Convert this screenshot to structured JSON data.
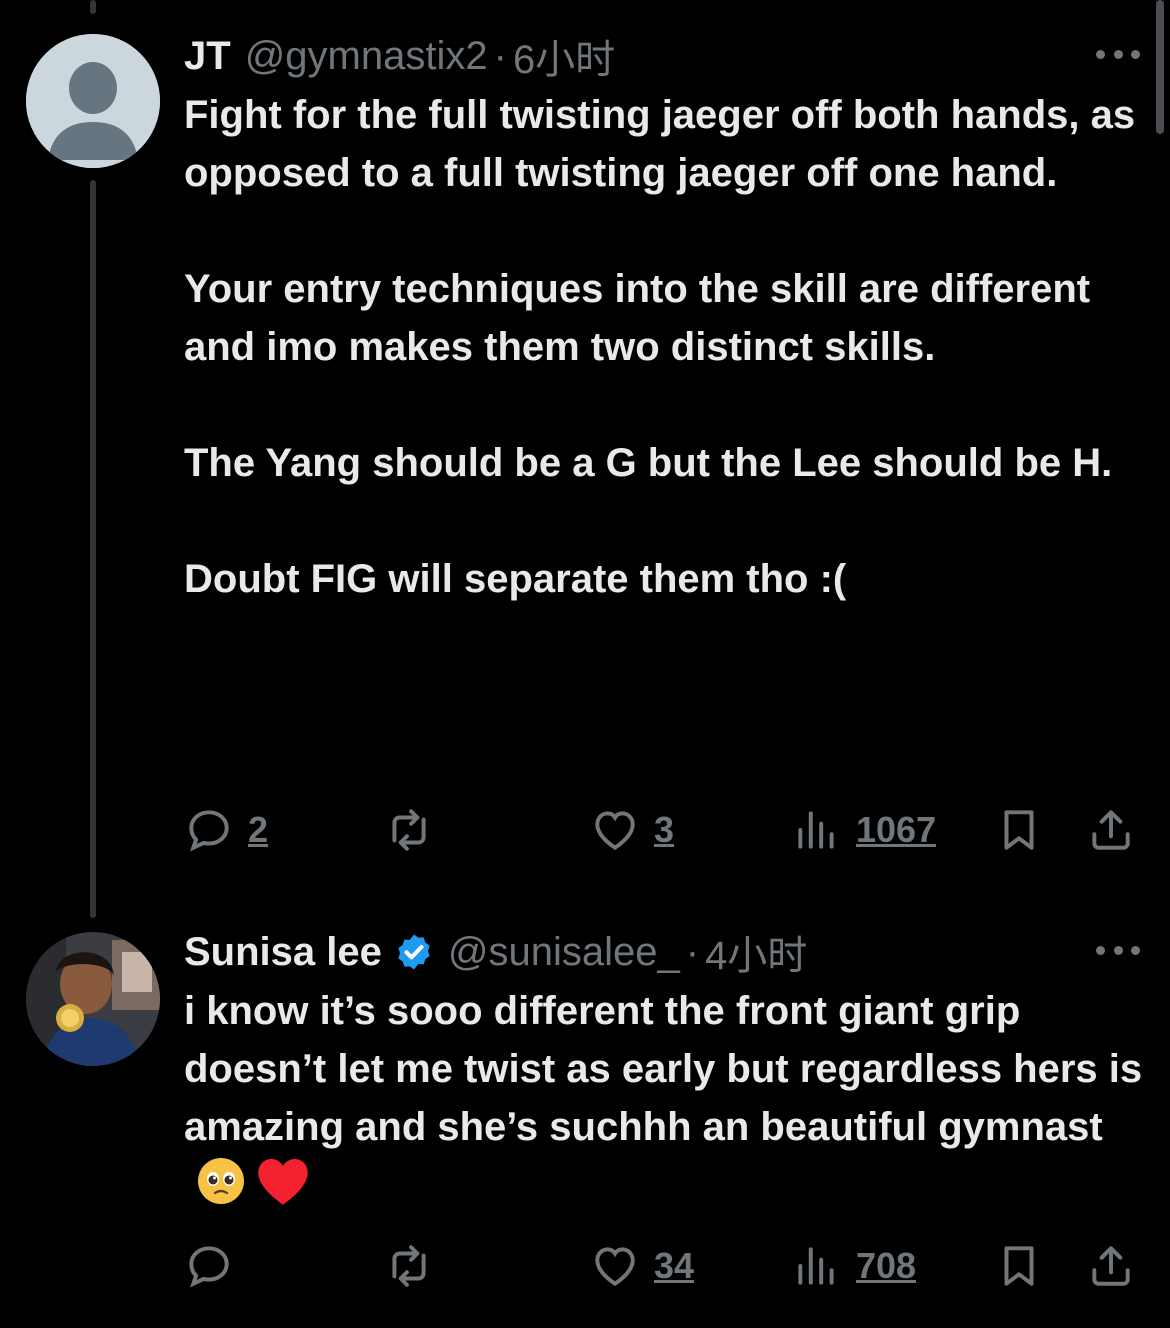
{
  "tweets": [
    {
      "name": "JT",
      "handle": "@gymnastix2",
      "separator": "·",
      "time": "6小时",
      "text": "Fight for the full twisting jaeger off both hands, as opposed to a full twisting jaeger off one hand.\n\nYour entry techniques into the skill are different and imo makes them two distinct skills.\n\nThe Yang should be a G but the Lee should be H.\n\nDoubt FIG will separate them tho :(",
      "replies": "2",
      "retweets": "",
      "likes": "3",
      "views": "1067",
      "avatar_icon": "default-user-avatar"
    },
    {
      "name": "Sunisa lee",
      "verified": true,
      "handle": "@sunisalee_",
      "separator": "·",
      "time": "4小时",
      "text": "i know it’s sooo different the front giant grip doesn’t let me twist as early but regardless hers is amazing and she’s suchhh an beautiful gymnast",
      "emojis": [
        "pleading-face-emoji",
        "red-heart-emoji"
      ],
      "replies": "",
      "retweets": "",
      "likes": "34",
      "views": "708",
      "avatar_icon": "profile-photo"
    }
  ],
  "colors": {
    "background": "#000000",
    "text": "#e7e9ea",
    "muted": "#71767b",
    "verified": "#1d9bf0",
    "heart": "#f4212e"
  }
}
